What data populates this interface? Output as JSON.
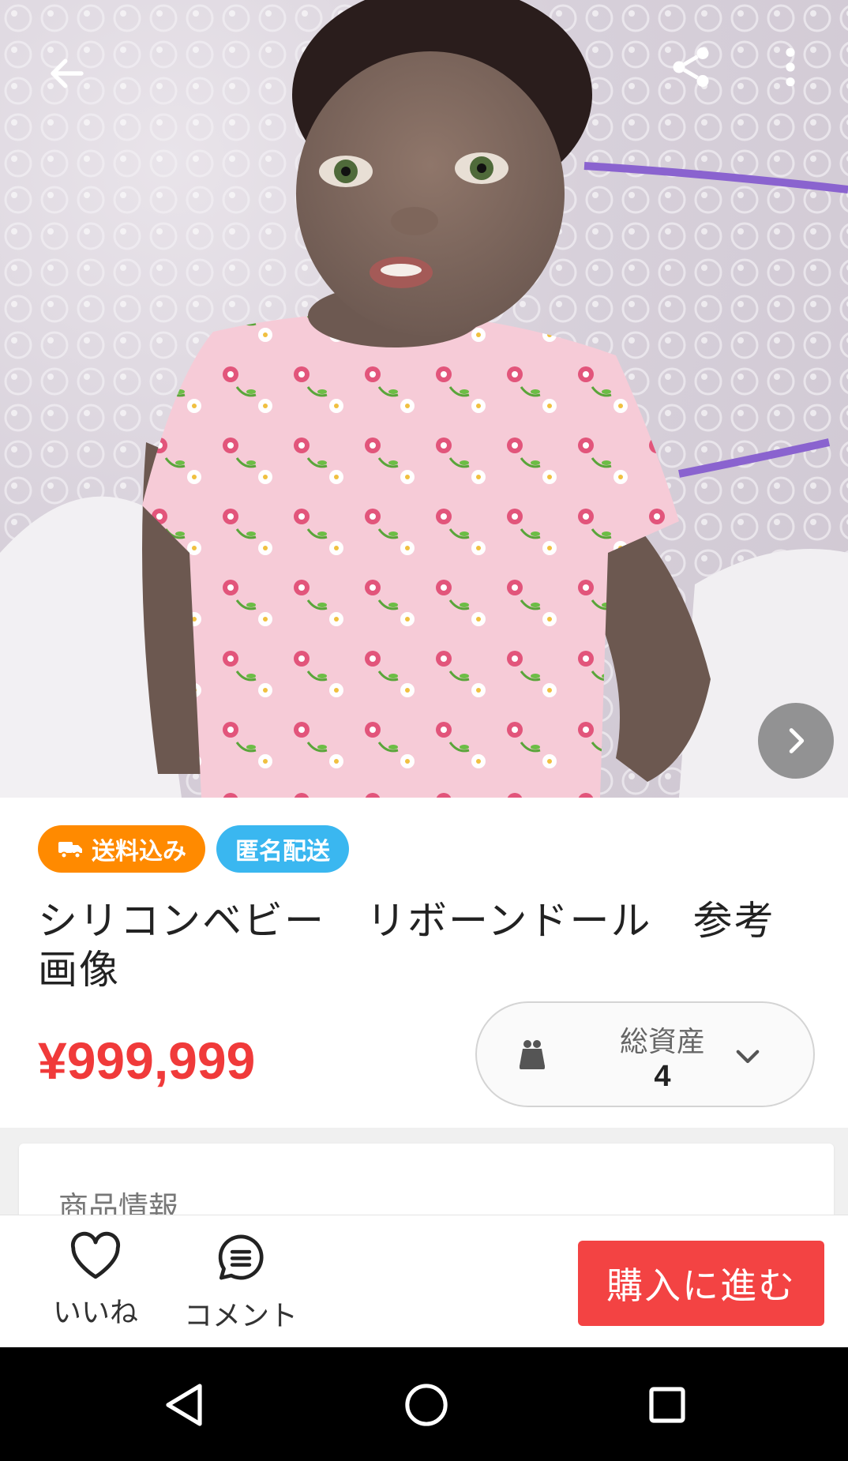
{
  "header": {
    "back_icon": "arrow-left-icon",
    "share_icon": "share-icon",
    "more_icon": "more-vertical-icon",
    "next_icon": "chevron-right-icon"
  },
  "badges": {
    "shipping": "送料込み",
    "anonymous": "匿名配送",
    "shipping_color": "#ff8a00",
    "anonymous_color": "#3ab7f0"
  },
  "product": {
    "title": "シリコンベビー　リボーンドール　参考画像",
    "price": "¥999,999",
    "price_color": "#f03a3a"
  },
  "assets": {
    "label": "総資産",
    "value": "4",
    "icon": "wallet-icon"
  },
  "section": {
    "title": "商品情報"
  },
  "actions": {
    "like_label": "いいね",
    "comment_label": "コメント",
    "buy_label": "購入に進む",
    "buy_color": "#f34343"
  },
  "system_nav": {
    "back": "triangle-back-icon",
    "home": "circle-home-icon",
    "recents": "square-recents-icon"
  }
}
